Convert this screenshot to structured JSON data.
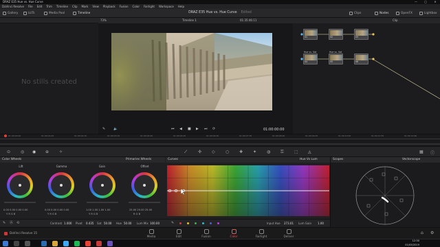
{
  "window": {
    "title": "DRAZ E35 Hue vs. Hue Curve",
    "controls": [
      "—",
      "▢",
      "✕"
    ]
  },
  "menu": [
    "DaVinci Resolve",
    "File",
    "Edit",
    "Trim",
    "Timeline",
    "Clip",
    "Mark",
    "View",
    "Playback",
    "Fusion",
    "Color",
    "Fairlight",
    "Workspace",
    "Help"
  ],
  "toolbar": {
    "gallery": "Gallery",
    "luts": "LUTs",
    "media_pool": "Media Pool",
    "timeline": "Timeline",
    "project_title": "DRAZ E35 Hue vs. Hue Curve",
    "edited": "Edited",
    "clips": "Clips",
    "nodes": "Nodes",
    "openfx": "OpenFX",
    "lightbox": "Lightbox"
  },
  "gallery": {
    "empty_text": "No stills created"
  },
  "viewer": {
    "zoom": "73%",
    "timeline_name": "Timeline 1",
    "timecode_top": "01:35:46:11",
    "clip_label": "Clip",
    "timecode": "01:00:00:00"
  },
  "nodes": [
    {
      "label": "01",
      "title": ""
    },
    {
      "label": "02",
      "title": ""
    },
    {
      "label": "03",
      "title": ""
    },
    {
      "label": "04",
      "title": "Hue vs. Sat"
    },
    {
      "label": "05",
      "title": "Hue vs. Sat"
    },
    {
      "label": "06",
      "title": ""
    }
  ],
  "timeline": {
    "ticks": [
      "01:00:00:00",
      "01:00:01:05",
      "01:00:02:10",
      "01:00:03:15",
      "01:00:04:20",
      "01:00:05:25",
      "01:00:06:30",
      "01:00:07:35",
      "01:00:08:40",
      "01:00:09:45",
      "01:00:10:50",
      "01:00:11:55",
      "01:00:12:60"
    ]
  },
  "color_wheels": {
    "header": "Color Wheels",
    "mode": "Primaries Wheels",
    "wheels": [
      {
        "name": "Lift",
        "vals": "0.00  0.00  0.00  0.00",
        "rgb": "Y  R  G  B"
      },
      {
        "name": "Gamma",
        "vals": "0.00  0.00  0.00  0.00",
        "rgb": "Y  R  G  B"
      },
      {
        "name": "Gain",
        "vals": "1.00  1.00  1.00  1.00",
        "rgb": "Y  R  G  B"
      },
      {
        "name": "Offset",
        "vals": "25.00  25.00  25.00",
        "rgb": "R  G  B"
      }
    ]
  },
  "bottom": {
    "contrast_label": "Contrast",
    "contrast": "1.000",
    "pivot_label": "Pivot",
    "pivot": "0.435",
    "sat_label": "Sat",
    "sat": "50.00",
    "hue_label": "Hue",
    "hue": "50.00",
    "lummix_label": "Lum Mix",
    "lummix": "100.00"
  },
  "curves": {
    "header": "Curves",
    "mode": "Hue Vs Lum",
    "input_hue_label": "Input Hue",
    "input_hue": "273.01",
    "lum_gain_label": "Lum Gain",
    "lum_gain": "1.00"
  },
  "scopes": {
    "header": "Scopes",
    "mode": "Vectorscope"
  },
  "pages": [
    {
      "name": "Media"
    },
    {
      "name": "Edit"
    },
    {
      "name": "Fusion"
    },
    {
      "name": "Color"
    },
    {
      "name": "Fairlight"
    },
    {
      "name": "Deliver"
    }
  ],
  "app_name": "DaVinci Resolve 15",
  "clock": {
    "time": "12:30",
    "date": "01/05/2019"
  }
}
